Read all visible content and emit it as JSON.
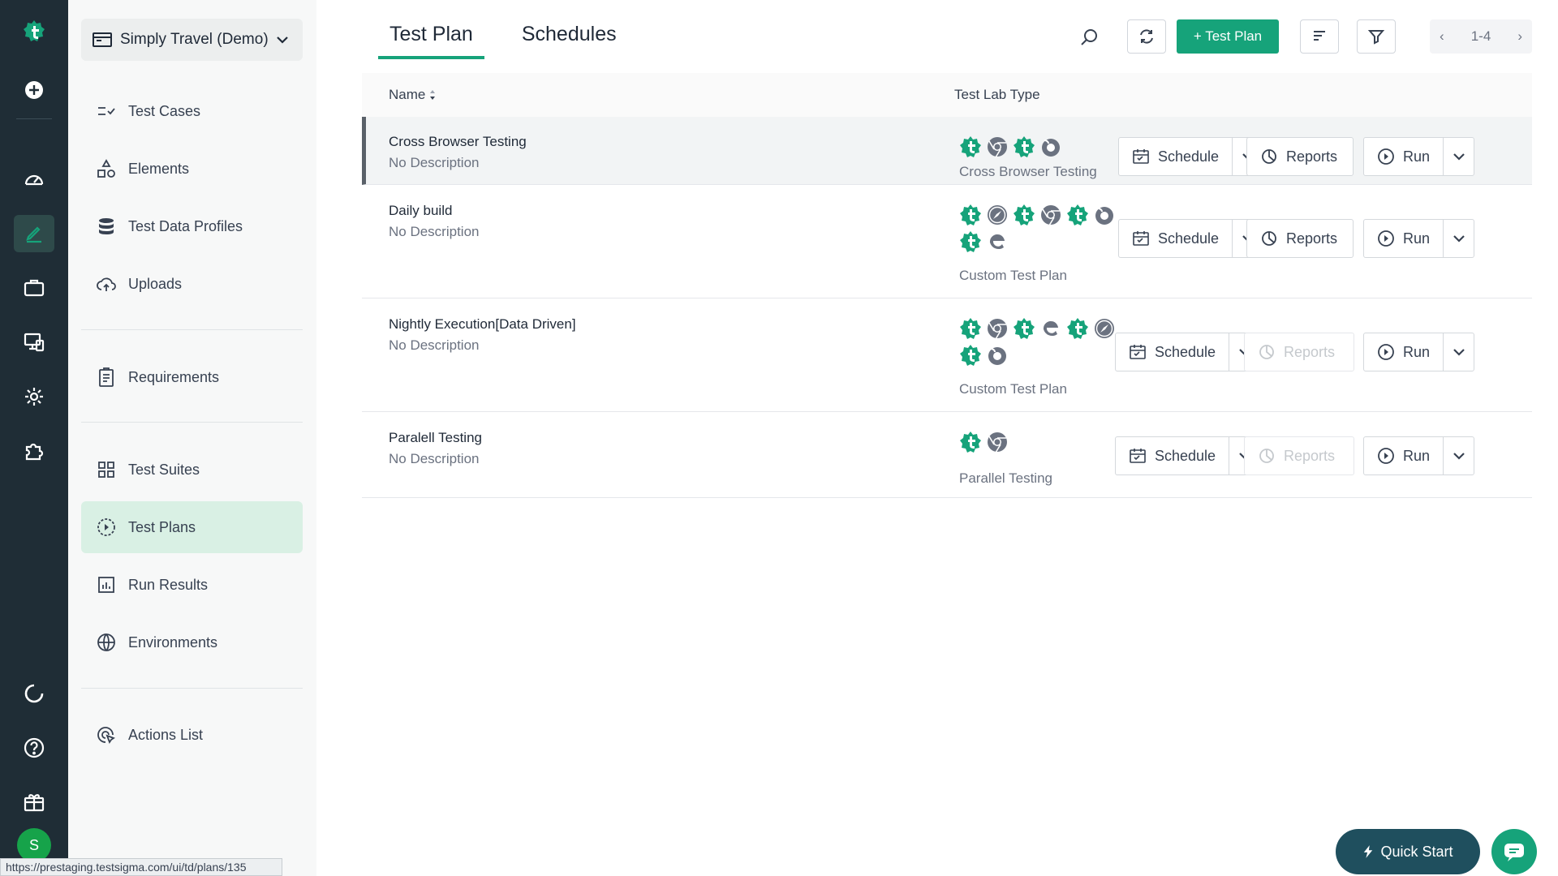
{
  "workspace": {
    "name": "Simply Travel (Demo)"
  },
  "sidebar": {
    "items": [
      {
        "label": "Test Cases",
        "icon": "test-cases-icon"
      },
      {
        "label": "Elements",
        "icon": "elements-icon"
      },
      {
        "label": "Test Data Profiles",
        "icon": "database-icon"
      },
      {
        "label": "Uploads",
        "icon": "cloud-upload-icon"
      },
      {
        "label": "Requirements",
        "icon": "clipboard-icon"
      },
      {
        "label": "Test Suites",
        "icon": "grid-icon"
      },
      {
        "label": "Test Plans",
        "icon": "play-circle-icon"
      },
      {
        "label": "Run Results",
        "icon": "bar-chart-icon"
      },
      {
        "label": "Environments",
        "icon": "globe-icon"
      },
      {
        "label": "Actions List",
        "icon": "cursor-click-icon"
      }
    ]
  },
  "tabs": [
    {
      "label": "Test Plan"
    },
    {
      "label": "Schedules"
    }
  ],
  "toolbar": {
    "add_label": "+ Test Plan",
    "pagination": "1-4"
  },
  "table": {
    "columns": {
      "name": "Name",
      "lab": "Test Lab Type"
    },
    "rows": [
      {
        "name": "Cross Browser Testing",
        "description": "No Description",
        "lab_type": "Cross Browser Testing",
        "browsers": [
          "testsigma",
          "chrome",
          "testsigma",
          "firefox"
        ],
        "reports_enabled": true
      },
      {
        "name": "Daily build",
        "description": "No Description",
        "lab_type": "Custom Test Plan",
        "browsers": [
          "testsigma",
          "safari",
          "testsigma",
          "chrome",
          "testsigma",
          "firefox",
          "testsigma",
          "edge"
        ],
        "reports_enabled": true
      },
      {
        "name": "Nightly Execution[Data Driven]",
        "description": "No Description",
        "lab_type": "Custom Test Plan",
        "browsers": [
          "testsigma",
          "chrome",
          "testsigma",
          "edge",
          "testsigma",
          "safari",
          "testsigma",
          "firefox"
        ],
        "reports_enabled": false
      },
      {
        "name": "Paralell Testing",
        "description": "No Description",
        "lab_type": "Parallel Testing",
        "browsers": [
          "testsigma",
          "chrome"
        ],
        "reports_enabled": false
      }
    ],
    "actions": {
      "schedule": "Schedule",
      "reports": "Reports",
      "run": "Run"
    }
  },
  "quick_start": {
    "label": "Quick Start"
  },
  "status_bar": {
    "url": "https://prestaging.testsigma.com/ui/td/plans/135"
  },
  "colors": {
    "accent": "#16a37a",
    "rail": "#1f2d36",
    "active_nav": "#d9f0e4"
  }
}
